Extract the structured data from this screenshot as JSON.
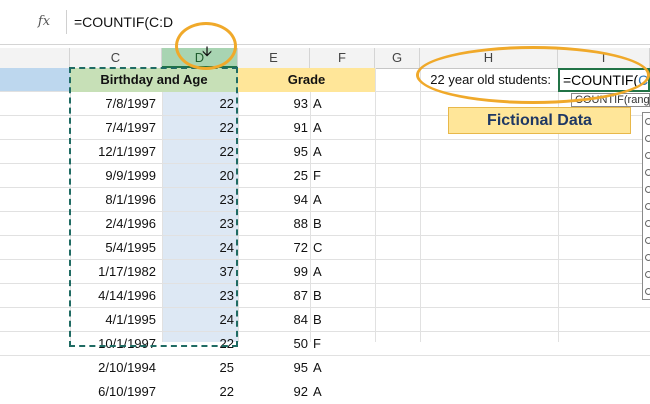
{
  "formula_bar": {
    "fx_label": "fx",
    "formula": "=COUNTIF(C:D"
  },
  "columns": [
    "C",
    "D",
    "E",
    "F",
    "G",
    "H",
    "I"
  ],
  "headers": {
    "birthday_age": "Birthday and Age",
    "grade": "Grade"
  },
  "rows": [
    {
      "date": "7/8/1997",
      "age": "22",
      "score": "93",
      "letter": "A"
    },
    {
      "date": "7/4/1997",
      "age": "22",
      "score": "91",
      "letter": "A"
    },
    {
      "date": "12/1/1997",
      "age": "22",
      "score": "95",
      "letter": "A"
    },
    {
      "date": "9/9/1999",
      "age": "20",
      "score": "25",
      "letter": "F"
    },
    {
      "date": "8/1/1996",
      "age": "23",
      "score": "94",
      "letter": "A"
    },
    {
      "date": "2/4/1996",
      "age": "23",
      "score": "88",
      "letter": "B"
    },
    {
      "date": "5/4/1995",
      "age": "24",
      "score": "72",
      "letter": "C"
    },
    {
      "date": "1/17/1982",
      "age": "37",
      "score": "99",
      "letter": "A"
    },
    {
      "date": "4/14/1996",
      "age": "23",
      "score": "87",
      "letter": "B"
    },
    {
      "date": "4/1/1995",
      "age": "24",
      "score": "84",
      "letter": "B"
    },
    {
      "date": "10/1/1997",
      "age": "22",
      "score": "50",
      "letter": "F"
    },
    {
      "date": "2/10/1994",
      "age": "25",
      "score": "95",
      "letter": "A"
    },
    {
      "date": "6/10/1997",
      "age": "22",
      "score": "92",
      "letter": "A"
    }
  ],
  "criteria_label": "22 year old students:",
  "editing_cell": {
    "prefix": "=COUNTIF(",
    "ref": "C:D"
  },
  "tooltip": "COUNTIF(range",
  "fictional_label": "Fictional Data",
  "colors": {
    "highlight": "#f0a92a",
    "selection_header": "#a8d4b2",
    "grade_header": "#ffe699",
    "birthday_header": "#c7e0b7",
    "ref_text": "#2e75b6"
  }
}
